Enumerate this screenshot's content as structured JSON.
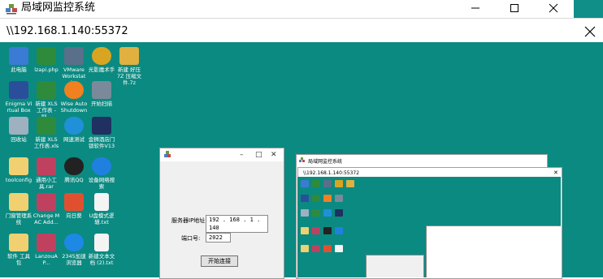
{
  "window": {
    "title": "局域网监控系统",
    "address": "\\\\192.168.1.140:55372"
  },
  "desktop_icons": [
    {
      "label": "此电脑",
      "color": "#3a7bd5"
    },
    {
      "label": "lzapi.php",
      "color": "#2e8b3c"
    },
    {
      "label": "VMware Workstati...",
      "color": "#5a6f8a"
    },
    {
      "label": "光影魔术手",
      "color": "#d9a520"
    },
    {
      "label": "新建 好压 7Z 压缩文件.7z",
      "color": "#e0b040"
    },
    {
      "label": "Enigma Virtual Box",
      "color": "#2a4f9a"
    },
    {
      "label": "新建 XLS 工作表 - 副...",
      "color": "#2e8b3c"
    },
    {
      "label": "Wise Auto Shutdown",
      "color": "#f08020"
    },
    {
      "label": "开始扫描",
      "color": "#7a8a9a"
    },
    {
      "label": "回收站",
      "color": "#9fb0c0"
    },
    {
      "label": "新建 XLS 工作表.xls",
      "color": "#2e8b3c"
    },
    {
      "label": "网速测试",
      "color": "#2090d8"
    },
    {
      "label": "金狮酒店门锁软件V13",
      "color": "#203060"
    },
    {
      "label": "toolconfig",
      "color": "#f0d070"
    },
    {
      "label": "通用小工具.rar",
      "color": "#c04060"
    },
    {
      "label": "腾讯QQ",
      "color": "#222222"
    },
    {
      "label": "设备网络搜索",
      "color": "#2080e0"
    },
    {
      "label": "门窗管理系统",
      "color": "#f0d070"
    },
    {
      "label": "Change MAC Add...",
      "color": "#c04060"
    },
    {
      "label": "向日葵",
      "color": "#e05030"
    },
    {
      "label": "U盘模式逻辑.txt",
      "color": "#f4f4f4"
    },
    {
      "label": "软件 工具包",
      "color": "#f0d070"
    },
    {
      "label": "LanzouAP...",
      "color": "#c04060"
    },
    {
      "label": "2345加速浏览器",
      "color": "#1e88e5"
    },
    {
      "label": "新建文本文档 (2).txt",
      "color": "#f4f4f4"
    }
  ],
  "client_window": {
    "server_ip_label": "服务器IP地址:",
    "server_ip_value": "192 . 168 . 1 . 140",
    "port_label": "端口号:",
    "port_value": "2022",
    "start_button": "开始连接"
  },
  "nested_window": {
    "title": "局域网监控系统",
    "address": "\\\\192.168.1.140:55372"
  },
  "colors": {
    "desktop_bg": "#0b8a81",
    "accent_strip": "#0f8f87"
  }
}
